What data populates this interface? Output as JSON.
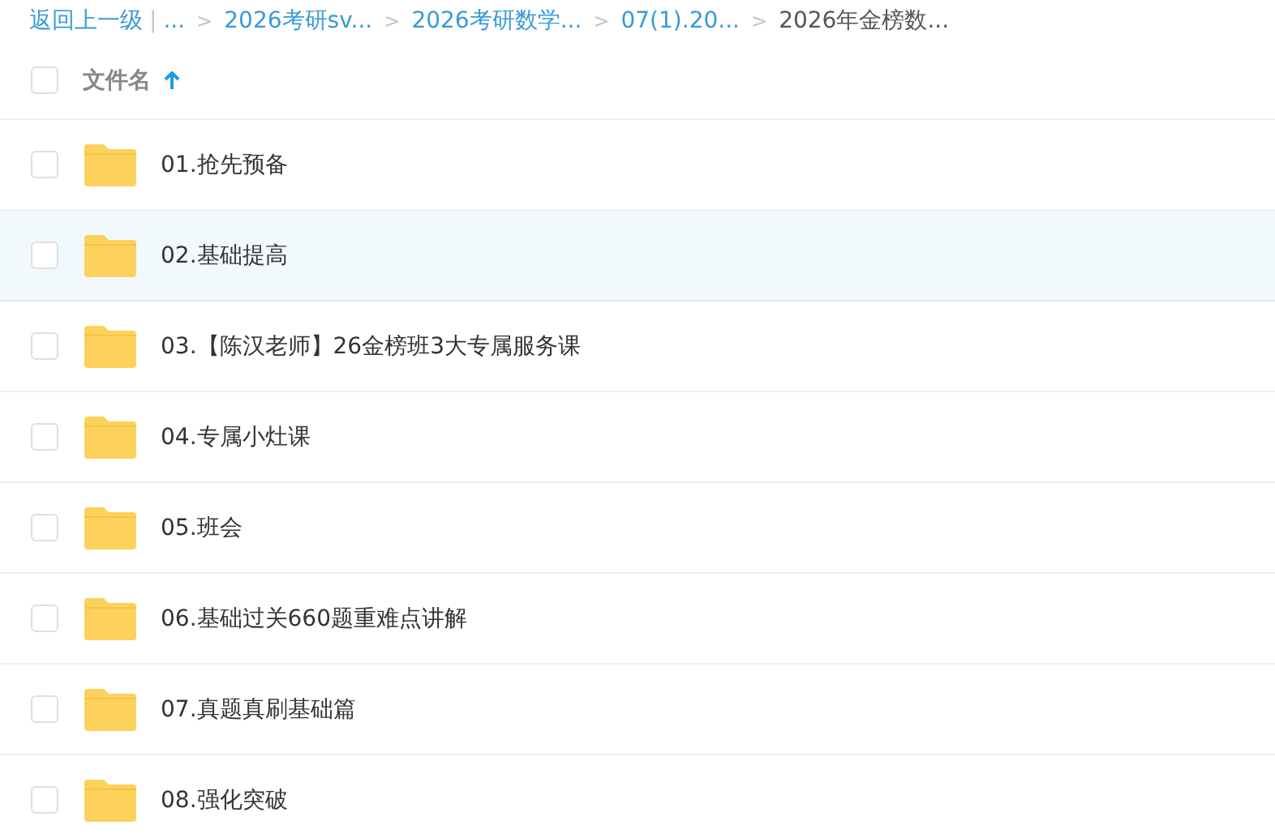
{
  "breadcrumb": [
    {
      "kind": "link",
      "label": "返回上一级"
    },
    {
      "kind": "divider",
      "label": "|"
    },
    {
      "kind": "link",
      "label": "..."
    },
    {
      "kind": "separator",
      "label": ">"
    },
    {
      "kind": "link",
      "label": "2026考研sv..."
    },
    {
      "kind": "separator",
      "label": ">"
    },
    {
      "kind": "link",
      "label": "2026考研数学..."
    },
    {
      "kind": "separator",
      "label": ">"
    },
    {
      "kind": "link",
      "label": "07(1).20..."
    },
    {
      "kind": "separator",
      "label": ">"
    },
    {
      "kind": "current",
      "label": "2026年金榜数..."
    }
  ],
  "header": {
    "checked": false,
    "column": "文件名"
  },
  "rows": [
    {
      "name": "01.抢先预备",
      "checked": false,
      "selected": false
    },
    {
      "name": "02.基础提高",
      "checked": false,
      "selected": true
    },
    {
      "name": "03.【陈汉老师】26金榜班3大专属服务课",
      "checked": false,
      "selected": false
    },
    {
      "name": "04.专属小灶课",
      "checked": false,
      "selected": false
    },
    {
      "name": "05.班会",
      "checked": false,
      "selected": false
    },
    {
      "name": "06.基础过关660题重难点讲解",
      "checked": false,
      "selected": false
    },
    {
      "name": "07.真题真刷基础篇",
      "checked": false,
      "selected": false
    },
    {
      "name": "08.强化突破",
      "checked": false,
      "selected": false
    }
  ]
}
